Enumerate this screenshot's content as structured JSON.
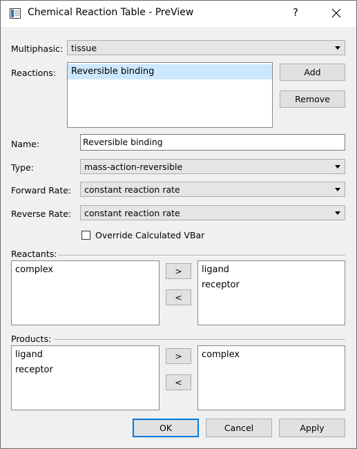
{
  "window": {
    "title": "Chemical Reaction Table - PreView",
    "help": "?"
  },
  "multiphasic": {
    "label": "Multiphasic:",
    "value": "tissue"
  },
  "reactions": {
    "label": "Reactions:",
    "items": [
      "Reversible binding"
    ],
    "add": "Add",
    "remove": "Remove"
  },
  "name": {
    "label": "Name:",
    "value": "Reversible binding"
  },
  "type": {
    "label": "Type:",
    "value": "mass-action-reversible"
  },
  "forward_rate": {
    "label": "Forward Rate:",
    "value": "constant reaction rate"
  },
  "reverse_rate": {
    "label": "Reverse Rate:",
    "value": "constant reaction rate"
  },
  "override": {
    "label": "Override Calculated VBar",
    "checked": false
  },
  "reactants": {
    "label": "Reactants:",
    "available": [
      "complex"
    ],
    "selected": [
      "ligand",
      "receptor"
    ],
    "move_right": ">",
    "move_left": "<"
  },
  "products": {
    "label": "Products:",
    "available": [
      "ligand",
      "receptor"
    ],
    "selected": [
      "complex"
    ],
    "move_right": ">",
    "move_left": "<"
  },
  "footer": {
    "ok": "OK",
    "cancel": "Cancel",
    "apply": "Apply"
  }
}
